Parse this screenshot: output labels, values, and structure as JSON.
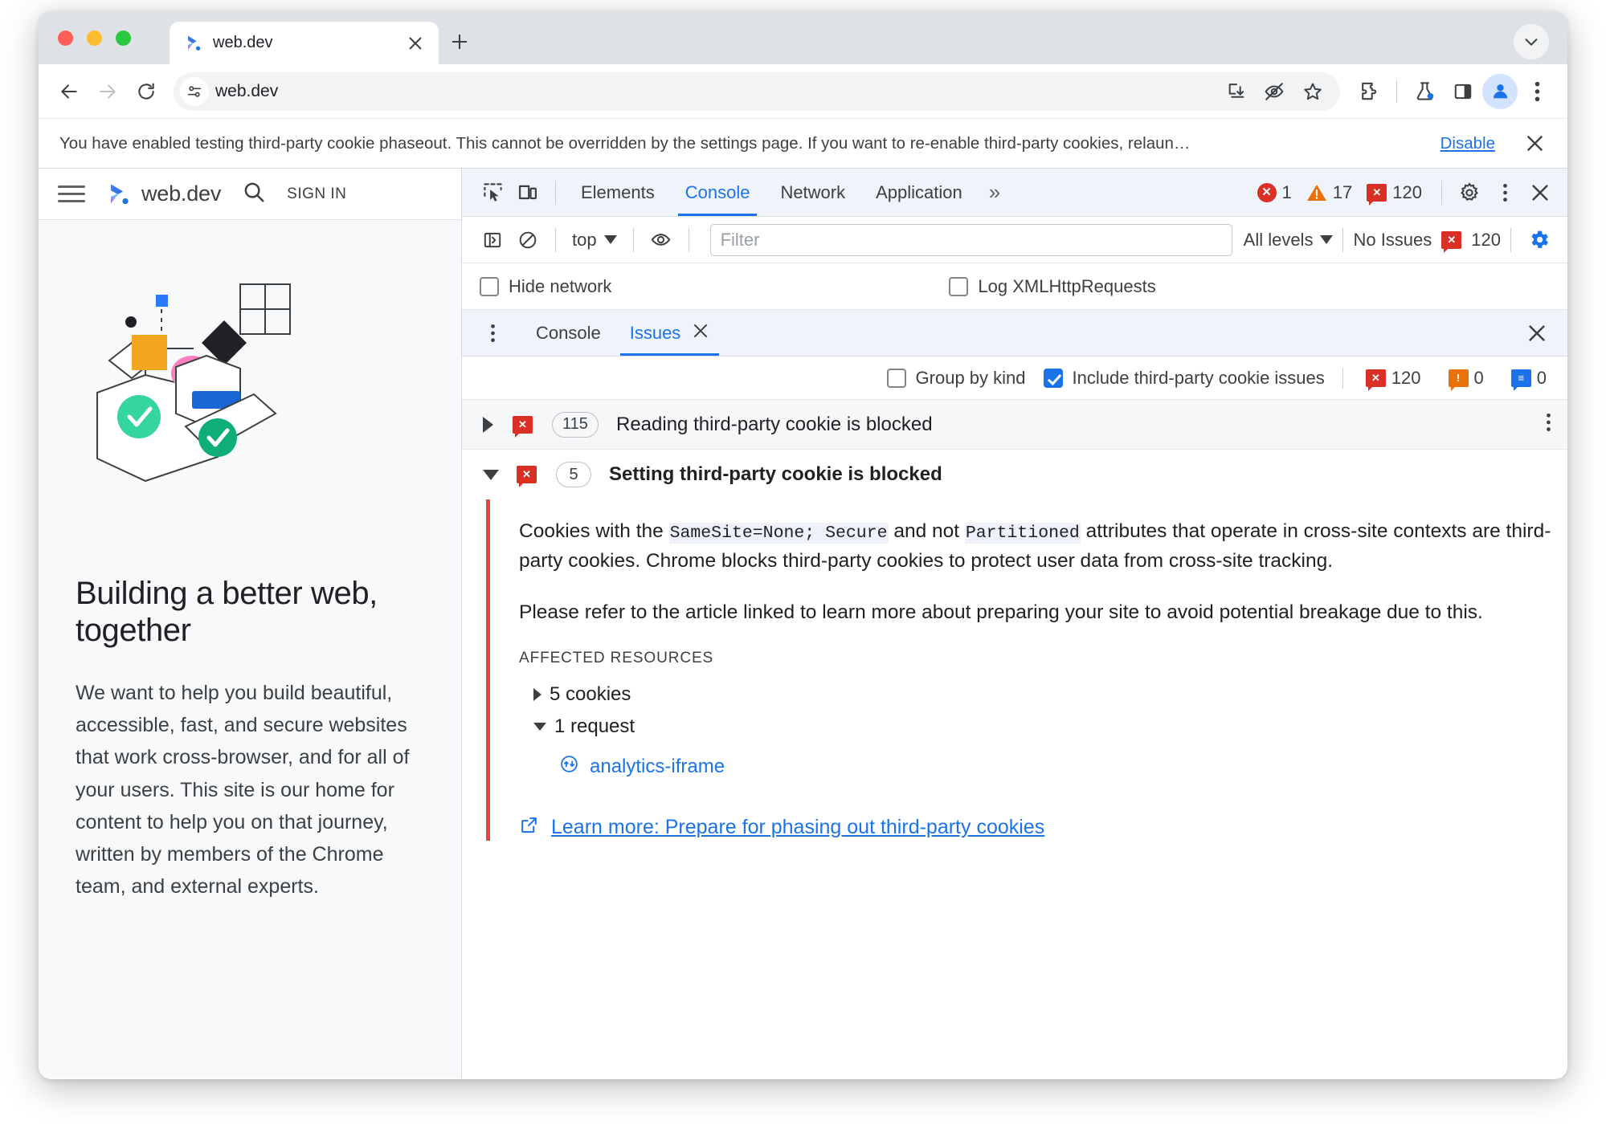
{
  "browser": {
    "tab": {
      "title": "web.dev",
      "favicon": "webdev-logo-icon",
      "close": "close-tab-icon"
    },
    "new_tab_label": "+",
    "omnibox": {
      "value": "web.dev",
      "site_info_icon": "site-settings-icon"
    },
    "toolbar_icons": [
      "install-app-icon",
      "incognito-eye-off-icon",
      "bookmark-star-icon",
      "extensions-puzzle-icon",
      "labs-flask-icon",
      "side-panel-icon",
      "profile-avatar-icon",
      "chrome-menu-icon"
    ],
    "nav": {
      "back": "back-arrow-icon",
      "forward": "forward-arrow-icon",
      "reload": "reload-icon"
    }
  },
  "infobar": {
    "message": "You have enabled testing third-party cookie phaseout. This cannot be overridden by the settings page. If you want to re-enable third-party cookies, relaun…",
    "action_label": "Disable",
    "close_icon": "close-icon"
  },
  "page": {
    "brand": "web.dev",
    "signin_label": "SIGN IN",
    "menu_icon": "hamburger-menu-icon",
    "search_icon": "search-icon",
    "heading": "Building a better web, together",
    "paragraph": "We want to help you build beautiful, accessible, fast, and secure websites that work cross-browser, and for all of your users. This site is our home for content to help you on that journey, written by members of the Chrome team, and external experts."
  },
  "devtools": {
    "inspect_icon": "inspect-element-icon",
    "device_toolbar_icon": "device-toolbar-icon",
    "tabs": [
      {
        "label": "Elements",
        "active": false
      },
      {
        "label": "Console",
        "active": true
      },
      {
        "label": "Network",
        "active": false
      },
      {
        "label": "Application",
        "active": false
      }
    ],
    "overflow_label": "»",
    "counts": {
      "errors": "1",
      "warnings": "17",
      "issues": "120"
    },
    "settings_icon": "gear-icon",
    "menu_icon": "more-vertical-icon",
    "close_icon": "close-icon",
    "console_toolbar": {
      "sidebar_icon": "console-sidebar-icon",
      "clear_icon": "clear-console-icon",
      "context": "top",
      "eye_icon": "live-expression-eye-icon",
      "filter_placeholder": "Filter",
      "filter_value": "",
      "levels_label": "All levels",
      "issues_label": "No Issues",
      "issues_count": "120",
      "settings_icon": "console-settings-gear-icon"
    },
    "console_options": [
      {
        "label": "Hide network",
        "checked": false
      },
      {
        "label": "Log XMLHttpRequests",
        "checked": false
      }
    ],
    "drawer": {
      "menu_icon": "drawer-more-icon",
      "tabs": [
        {
          "label": "Console",
          "active": false,
          "closable": false
        },
        {
          "label": "Issues",
          "active": true,
          "closable": true
        }
      ],
      "close_icon": "close-drawer-icon",
      "options": [
        {
          "label": "Group by kind",
          "checked": false
        },
        {
          "label": "Include third-party cookie issues",
          "checked": true
        }
      ],
      "counts": {
        "errors": "120",
        "warnings": "0",
        "info": "0"
      }
    },
    "issues": [
      {
        "title": "Reading third-party cookie is blocked",
        "count": "115",
        "expanded": false,
        "severity": "error"
      },
      {
        "title": "Setting third-party cookie is blocked",
        "count": "5",
        "expanded": true,
        "severity": "error",
        "detail": {
          "paragraph1_parts": [
            {
              "t": "Cookies with the ",
              "code": false
            },
            {
              "t": "SameSite=None; Secure",
              "code": true
            },
            {
              "t": " and not ",
              "code": false
            },
            {
              "t": "Partitioned",
              "code": true
            },
            {
              "t": " attributes that operate in cross-site contexts are third-party cookies. Chrome blocks third-party cookies to protect user data from cross-site tracking.",
              "code": false
            }
          ],
          "paragraph2": "Please refer to the article linked to learn more about preparing your site to avoid potential breakage due to this.",
          "affected_title": "AFFECTED RESOURCES",
          "resources": [
            {
              "label": "5 cookies",
              "expanded": false,
              "children": []
            },
            {
              "label": "1 request",
              "expanded": true,
              "children": [
                {
                  "label": "analytics-iframe",
                  "icon": "iframe-icon"
                }
              ]
            }
          ],
          "learn_more": {
            "label": "Learn more: Prepare for phasing out third-party cookies",
            "icon": "external-link-icon"
          }
        }
      }
    ]
  },
  "colors": {
    "accent_blue": "#1a73e8",
    "error_red": "#d93025",
    "warn_orange": "#e8710a",
    "devtools_chrome": "#f0f3f9"
  }
}
